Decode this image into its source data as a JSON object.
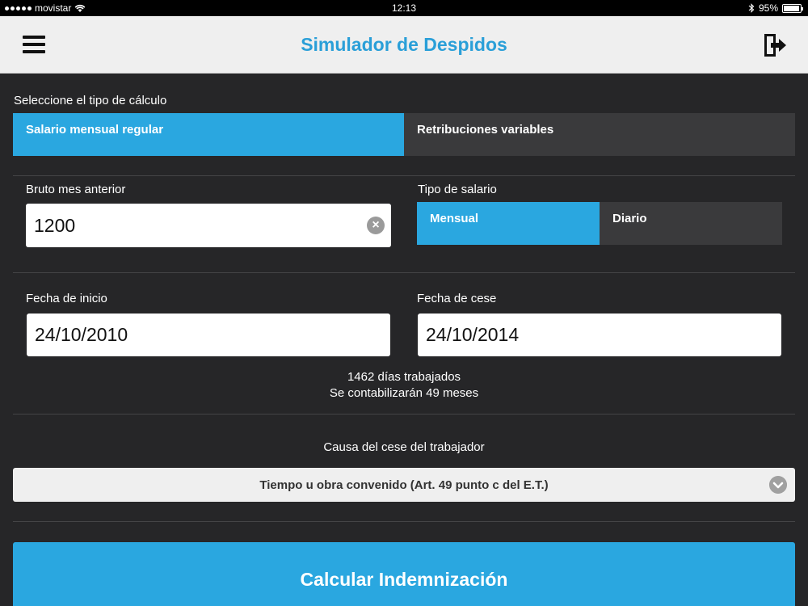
{
  "status_bar": {
    "carrier": "movistar",
    "time": "12:13",
    "battery": "95%",
    "battery_level": 0.95
  },
  "nav": {
    "title": "Simulador de Despidos"
  },
  "calc_type": {
    "label": "Seleccione el tipo de cálculo",
    "options": [
      "Salario mensual regular",
      "Retribuciones variables"
    ],
    "selected": "Salario mensual regular"
  },
  "gross": {
    "label": "Bruto mes anterior",
    "value": "1200"
  },
  "salary_type": {
    "label": "Tipo de salario",
    "options": [
      "Mensual",
      "Diario"
    ],
    "selected": "Mensual"
  },
  "start_date": {
    "label": "Fecha de inicio",
    "value": "24/10/2010"
  },
  "end_date": {
    "label": "Fecha de cese",
    "value": "24/10/2014"
  },
  "summary": {
    "days": "1462 días trabajados",
    "months": "Se contabilizarán 49 meses"
  },
  "cause": {
    "label": "Causa del cese del trabajador",
    "selected": "Tiempo u obra convenido (Art. 49 punto c del E.T.)"
  },
  "calculate_label": "Calcular Indemnización",
  "colors": {
    "accent": "#2aa7e0",
    "title": "#2a9fd8",
    "background": "#262628"
  }
}
